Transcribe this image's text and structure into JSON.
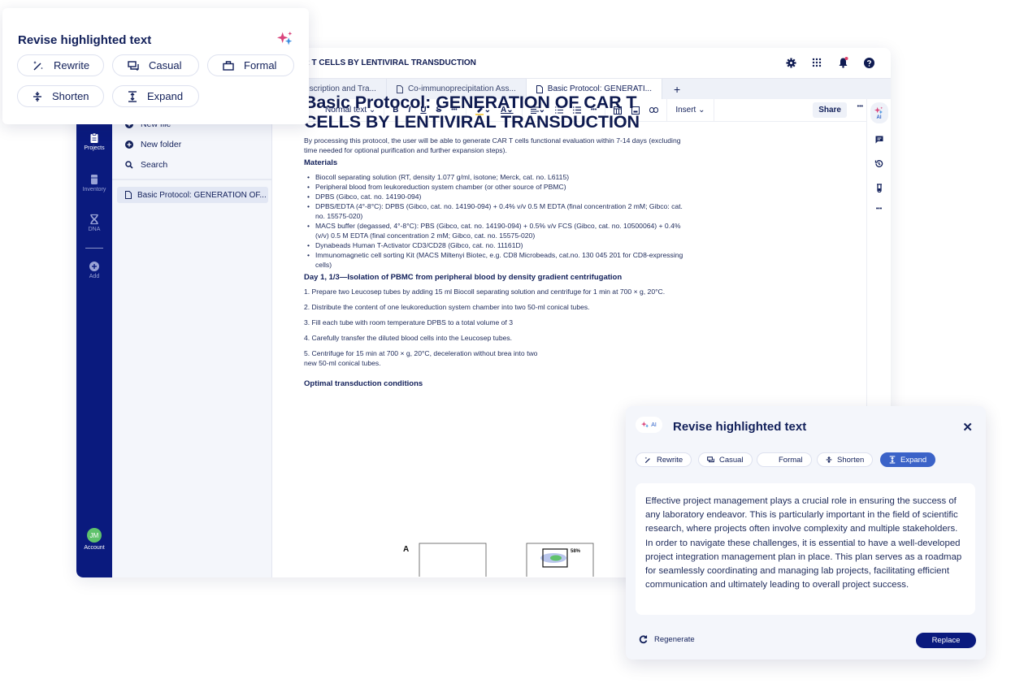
{
  "app": {
    "document_title_bar": "CAR T CELLS BY LENTIVIRAL TRANSDUCTION",
    "rail": {
      "items": [
        {
          "label": "Projects",
          "icon": "clipboard-icon",
          "active": true
        },
        {
          "label": "Inventory",
          "icon": "fridge-icon",
          "active": false
        },
        {
          "label": "DNA",
          "icon": "dna-icon",
          "active": false
        },
        {
          "label": "Add",
          "icon": "plus-circle-icon",
          "active": false
        }
      ],
      "account": {
        "initials": "JM",
        "label": "Account",
        "color": "#5fc26c"
      }
    },
    "file_panel": {
      "actions": [
        {
          "label": "New file",
          "icon": "plus-circle-icon"
        },
        {
          "label": "New folder",
          "icon": "plus-circle-icon"
        },
        {
          "label": "Search",
          "icon": "search-icon"
        }
      ],
      "files": [
        {
          "label": "Basic Protocol: GENERATION OF...",
          "selected": true
        }
      ]
    },
    "top_icons": [
      "gear-icon",
      "apps-grid-icon",
      "bell-icon",
      "help-icon"
    ],
    "tabs": [
      {
        "label": "ro Transcription and Tra...",
        "active": false
      },
      {
        "label": "Co-immunoprecipitation Ass...",
        "active": false
      },
      {
        "label": "Basic Protocol: GENERATI...",
        "active": true
      }
    ],
    "toolbar": {
      "text_style": "Normal text",
      "bold": "B",
      "italic": "I",
      "underline": "U",
      "strike": "S",
      "more": "•••",
      "insert": "Insert",
      "share": "Share"
    },
    "side_tools": {
      "ai_label": "AI"
    },
    "document": {
      "title": "Basic Protocol: GENERATION OF CAR T CELLS BY LENTIVIRAL TRANSDUCTION",
      "intro": "By processing this protocol, the user will be able to generate CAR T cells functional evaluation within 7-14 days (excluding time needed for optional purification and further expansion steps).",
      "materials_heading": "Materials",
      "materials": [
        "Biocoll separating solution (RT, density 1.077 g/ml, isotone; Merck, cat. no. L6115)",
        "Peripheral blood from leukoreduction system chamber (or other source of PBMC)",
        "DPBS (Gibco, cat. no. 14190-094)",
        "DPBS/EDTA (4°-8°C): DPBS (Gibco, cat. no. 14190-094) + 0.4% v/v 0.5 M EDTA (final concentration 2 mM; Gibco: cat. no. 15575-020)",
        "MACS buffer (degassed, 4°-8°C): PBS (Gibco, cat. no. 14190-094) + 0.5% v/v FCS (Gibco, cat. no. 10500064) + 0.4% (v/v) 0.5 M EDTA (final concentration 2 mM; Gibco, cat. no. 15575-020)",
        "Dynabeads Human T-Activator CD3/CD28 (Gibco, cat. no. 11161D)",
        "Immunomagnetic cell sorting Kit (MACS Miltenyi Biotec, e.g. CD8 Microbeads, cat.no. 130 045 201 for CD8-expressing cells)"
      ],
      "day_heading": "Day 1, 1/3—Isolation of PBMC from peripheral blood by density gradient centrifugation",
      "steps": [
        "1. Prepare two Leucosep tubes by adding 15 ml Biocoll separating solution and centrifuge for 1 min at 700 × g, 20°C.",
        "2. Distribute the content of one leukoreduction system chamber into two 50-ml conical tubes.",
        "3. Fill each tube with room temperature DPBS to a total volume of 3",
        "4. Carefully transfer the diluted blood cells into the Leucosep tubes.",
        "5. Centrifuge for 15 min at 700 × g, 20°C, deceleration without brea into two new 50-ml conical tubes."
      ],
      "optimal_heading": "Optimal transduction conditions",
      "figure": {
        "panel_label": "A",
        "gate_percent": "58%"
      }
    }
  },
  "revise_card": {
    "title": "Revise highlighted text",
    "options": [
      {
        "label": "Rewrite",
        "icon": "magic-wand-icon"
      },
      {
        "label": "Casual",
        "icon": "chat-icon"
      },
      {
        "label": "Formal",
        "icon": "briefcase-icon"
      },
      {
        "label": "Shorten",
        "icon": "shorten-icon"
      },
      {
        "label": "Expand",
        "icon": "expand-icon"
      }
    ]
  },
  "ai_panel": {
    "badge": "AI",
    "title": "Revise highlighted text",
    "options": [
      {
        "label": "Rewrite",
        "active": false
      },
      {
        "label": "Casual",
        "active": false
      },
      {
        "label": "Formal",
        "active": false
      },
      {
        "label": "Shorten",
        "active": false
      },
      {
        "label": "Expand",
        "active": true
      }
    ],
    "result": "Effective project management plays a crucial role in ensuring the success of any laboratory endeavor. This is particularly important in the field of scientific research, where projects often involve complexity and multiple stakeholders. In order to navigate these challenges, it is essential to have a well-developed project integration management plan in place. This plan serves as a roadmap for seamlessly coordinating and managing lab projects, facilitating efficient communication and ultimately leading to overall project success.",
    "regenerate_label": "Regenerate",
    "replace_label": "Replace",
    "accent_color": "#3b63c8",
    "primary_color": "#0a1a7e"
  }
}
